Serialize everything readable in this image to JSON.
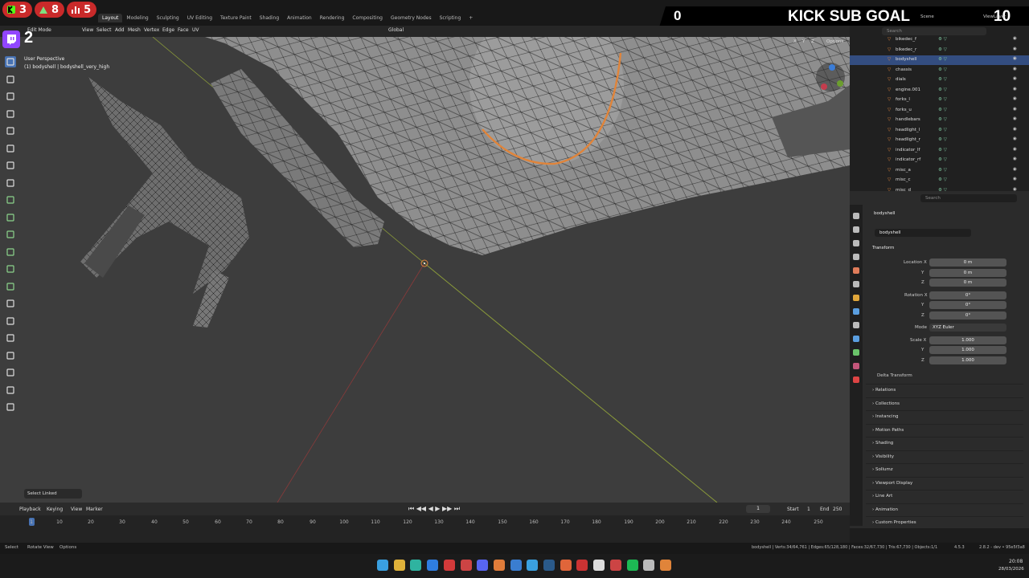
{
  "workspace_tabs": [
    "Layout",
    "Modeling",
    "Sculpting",
    "UV Editing",
    "Texture Paint",
    "Shading",
    "Animation",
    "Rendering",
    "Compositing",
    "Geometry Nodes",
    "Scripting",
    "+"
  ],
  "overlay": {
    "badges": [
      {
        "icon": "kick-icon",
        "value": "3"
      },
      {
        "icon": "person-icon",
        "value": "8"
      },
      {
        "icon": "bars-icon",
        "value": "5"
      }
    ],
    "twitch_count": "2",
    "kick_left": "0",
    "kick_title": "KICK SUB GOAL",
    "kick_right": "10"
  },
  "header": {
    "mode": "Edit Mode",
    "menu": [
      "View",
      "Select",
      "Add",
      "Mesh",
      "Vertex",
      "Edge",
      "Face",
      "UV"
    ],
    "orientation": "Global",
    "options": "Options",
    "axes": [
      "X",
      "Y",
      "Z"
    ]
  },
  "viewport": {
    "perspective": "User Perspective",
    "object_line": "(1) bodyshell | bodyshell_very_high",
    "select_linked": "Select Linked"
  },
  "outliner": {
    "scene": "Scene",
    "viewlayer": "ViewLayer",
    "search": "Search",
    "items": [
      {
        "name": "bikedec_f",
        "selected": false
      },
      {
        "name": "bikedec_r",
        "selected": false
      },
      {
        "name": "bodyshell",
        "selected": true
      },
      {
        "name": "chassis",
        "selected": false
      },
      {
        "name": "dials",
        "selected": false
      },
      {
        "name": "engine.001",
        "selected": false
      },
      {
        "name": "forks_l",
        "selected": false
      },
      {
        "name": "forks_u",
        "selected": false
      },
      {
        "name": "handlebars",
        "selected": false
      },
      {
        "name": "headlight_l",
        "selected": false
      },
      {
        "name": "headlight_r",
        "selected": false
      },
      {
        "name": "indicator_lf",
        "selected": false
      },
      {
        "name": "indicator_rf",
        "selected": false
      },
      {
        "name": "misc_a",
        "selected": false
      },
      {
        "name": "misc_c",
        "selected": false
      },
      {
        "name": "misc_d",
        "selected": false
      }
    ]
  },
  "properties": {
    "search": "Search",
    "object_name": "bodyshell",
    "data_name": "bodyshell",
    "transform": "Transform",
    "location_label": "Location X",
    "loc": [
      "0 m",
      "0 m",
      "0 m"
    ],
    "rotation_label": "Rotation X",
    "rot": [
      "0°",
      "0°",
      "0°"
    ],
    "mode_label": "Mode",
    "mode_value": "XYZ Euler",
    "scale_label": "Scale X",
    "scale": [
      "1.000",
      "1.000",
      "1.000"
    ],
    "y": "Y",
    "z": "Z",
    "delta": "Delta Transform",
    "sections": [
      "Relations",
      "Collections",
      "Instancing",
      "Motion Paths",
      "Shading",
      "Visibility",
      "Sollumz",
      "Viewport Display",
      "Line Art",
      "Animation",
      "Custom Properties"
    ]
  },
  "timeline": {
    "menu": [
      "Playback",
      "Keying",
      "View",
      "Marker"
    ],
    "current": "1",
    "start_label": "Start",
    "start": "1",
    "end_label": "End",
    "end": "250",
    "ticks": [
      "1",
      "10",
      "20",
      "30",
      "40",
      "50",
      "60",
      "70",
      "80",
      "90",
      "100",
      "110",
      "120",
      "130",
      "140",
      "150",
      "160",
      "170",
      "180",
      "190",
      "200",
      "210",
      "220",
      "230",
      "240",
      "250"
    ]
  },
  "status": {
    "left": [
      "Select",
      "Rotate View",
      "Options"
    ],
    "stats": "bodyshell | Verts:34/64,761 | Edges:65/128,180 | Faces:32/67,730 | Tris:67,730 | Objects:1/1",
    "version": "4.5.3",
    "build": "2.8.2 - dev • 95e5f3a8"
  },
  "clock": {
    "time": "20:08",
    "date": "28/03/2026"
  },
  "colors": {
    "accent": "#4772b3",
    "badge": "#c92a2a",
    "twitch": "#9146ff",
    "orange": "#e0843a"
  }
}
